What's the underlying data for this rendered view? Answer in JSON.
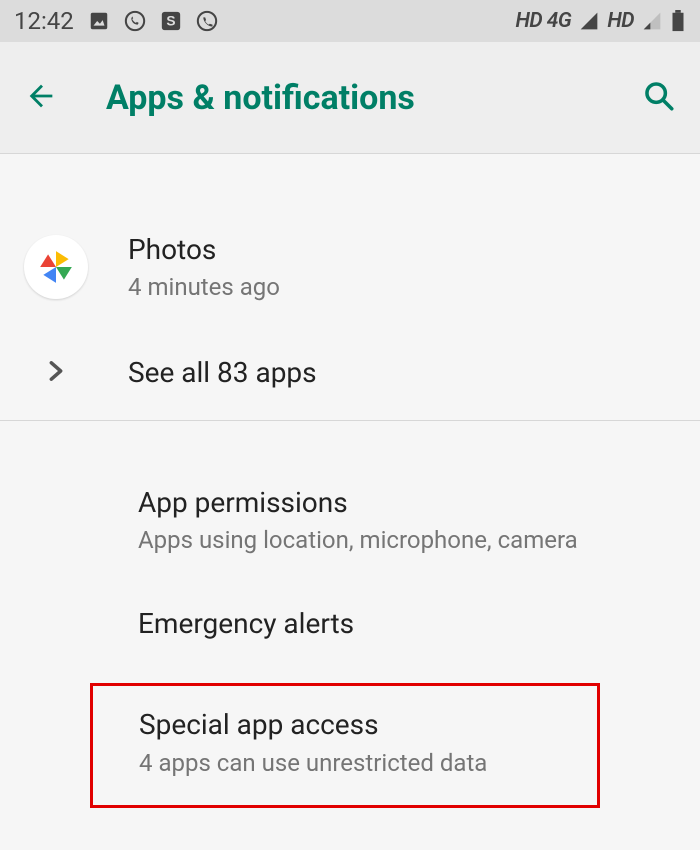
{
  "status_bar": {
    "time": "12:42",
    "icons": [
      "image-icon",
      "whatsapp-icon",
      "s-icon",
      "phone-icon"
    ],
    "signal1_label": "HD 4G",
    "signal2_label": "HD"
  },
  "app_bar": {
    "title": "Apps & notifications"
  },
  "photos_row": {
    "title": "Photos",
    "sub": "4 minutes ago"
  },
  "see_all": {
    "label": "See all 83 apps"
  },
  "app_permissions": {
    "title": "App permissions",
    "sub": "Apps using location, microphone, camera"
  },
  "emergency_alerts": {
    "title": "Emergency alerts"
  },
  "special_app_access": {
    "title": "Special app access",
    "sub": "4 apps can use unrestricted data"
  }
}
